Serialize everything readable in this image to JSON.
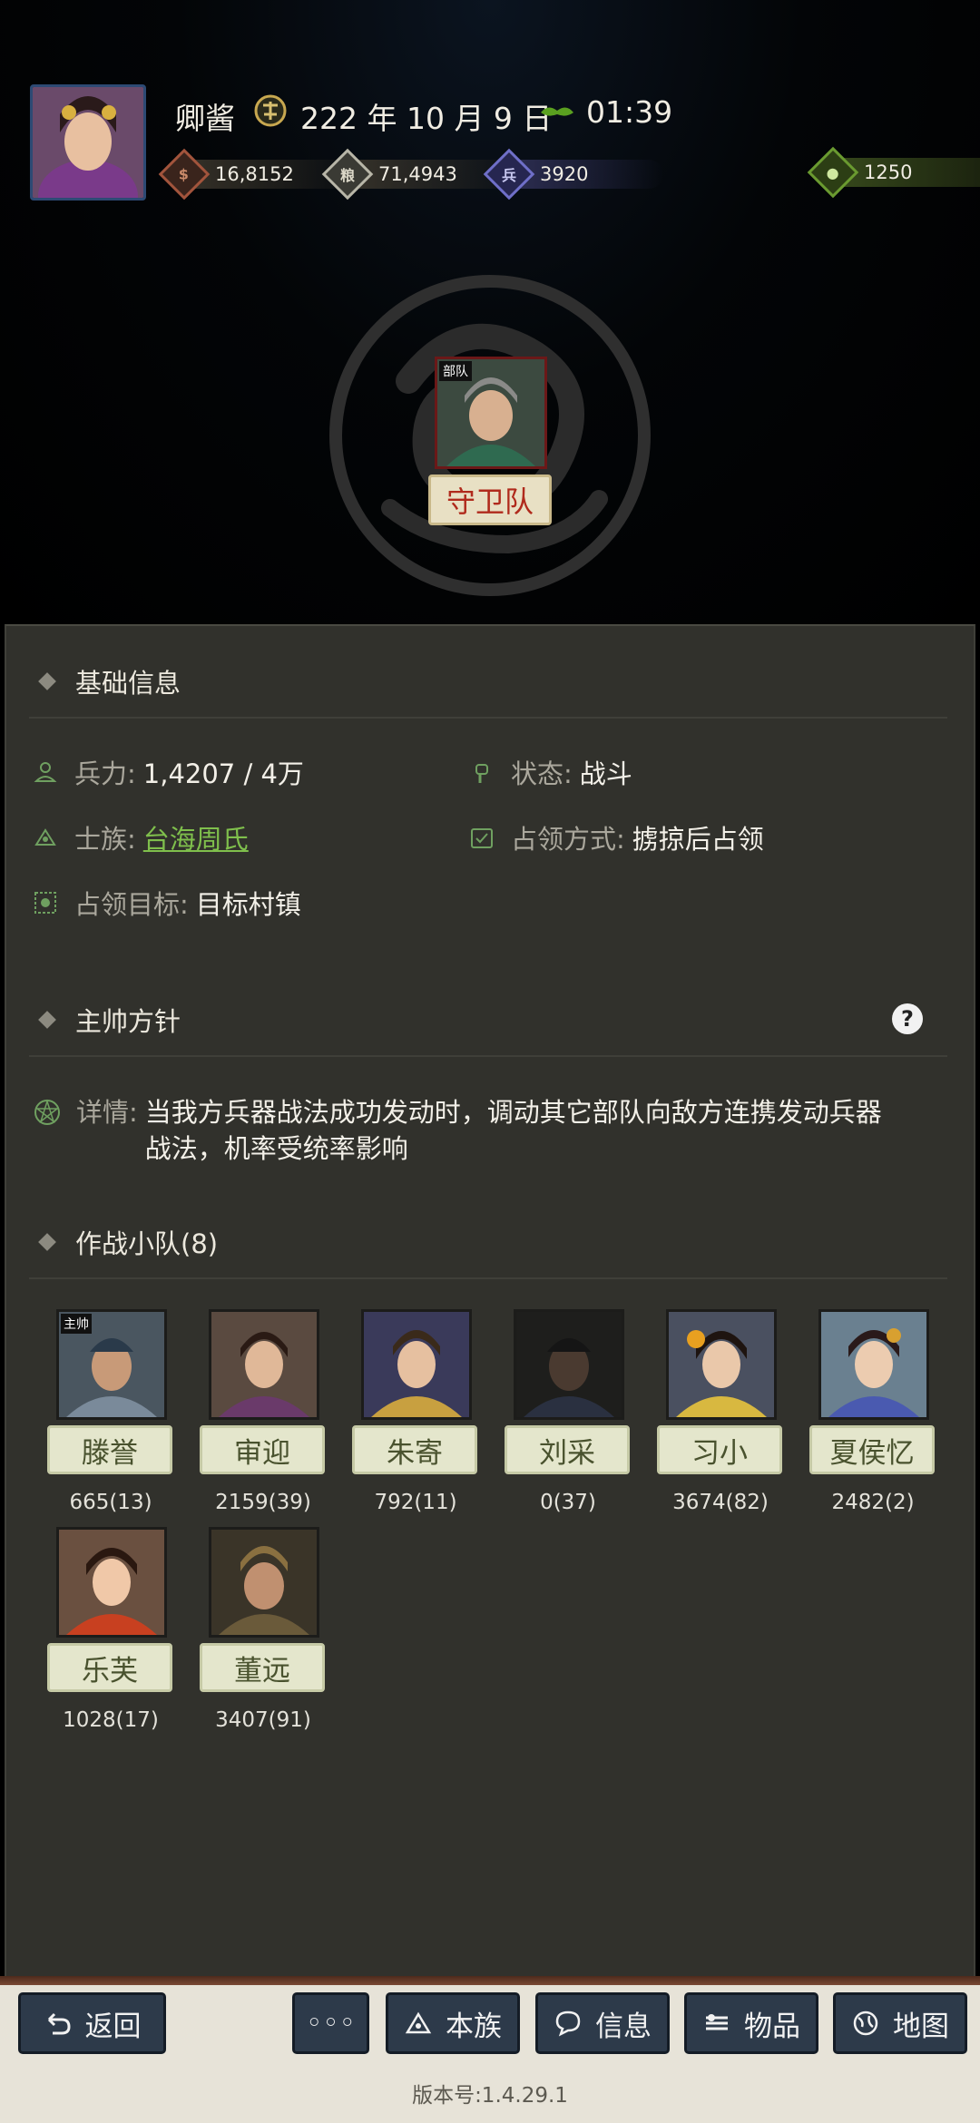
{
  "header": {
    "player_name": "卿酱",
    "date": "222 年 10 月 9 日",
    "time": "01:39",
    "resources": [
      {
        "icon": "money-bag-icon",
        "value": "16,8152",
        "color": "#a2543c"
      },
      {
        "icon": "grain-icon",
        "value": "71,4943",
        "color": "#b8b6a8"
      },
      {
        "icon": "soldier-icon",
        "value": "3920",
        "color": "#6f6fc8"
      },
      {
        "icon": "gourd-icon",
        "value": "1250",
        "color": "#6a9a30"
      }
    ]
  },
  "unit": {
    "tag": "部队",
    "name": "守卫队"
  },
  "basic_info": {
    "title": "基础信息",
    "troops_label": "兵力:",
    "troops_value": "1,4207 / 4万",
    "status_label": "状态:",
    "status_value": "战斗",
    "clan_label": "士族:",
    "clan_value": "台海周氏",
    "occupy_mode_label": "占领方式:",
    "occupy_mode_value": "掳掠后占领",
    "target_label": "占领目标:",
    "target_value": "目标村镇"
  },
  "commander_policy": {
    "title": "主帅方针",
    "help": "?",
    "detail_label": "详情:",
    "detail_value": "当我方兵器战法成功发动时，调动其它部队向敌方连携发动兵器战法，机率受统率影响"
  },
  "squad": {
    "title": "作战小队(8)",
    "leader_tag": "主帅",
    "members": [
      {
        "name": "滕誉",
        "stat": "665(13)"
      },
      {
        "name": "审迎",
        "stat": "2159(39)"
      },
      {
        "name": "朱寄",
        "stat": "792(11)"
      },
      {
        "name": "刘采",
        "stat": "0(37)"
      },
      {
        "name": "习小",
        "stat": "3674(82)"
      },
      {
        "name": "夏侯忆",
        "stat": "2482(2)"
      },
      {
        "name": "乐芙",
        "stat": "1028(17)"
      },
      {
        "name": "董远",
        "stat": "3407(91)"
      }
    ]
  },
  "nav": {
    "back": "返回",
    "more": "◦◦◦",
    "clan": "本族",
    "info": "信息",
    "items": "物品",
    "map": "地图"
  },
  "version": "版本号:1.4.29.1"
}
